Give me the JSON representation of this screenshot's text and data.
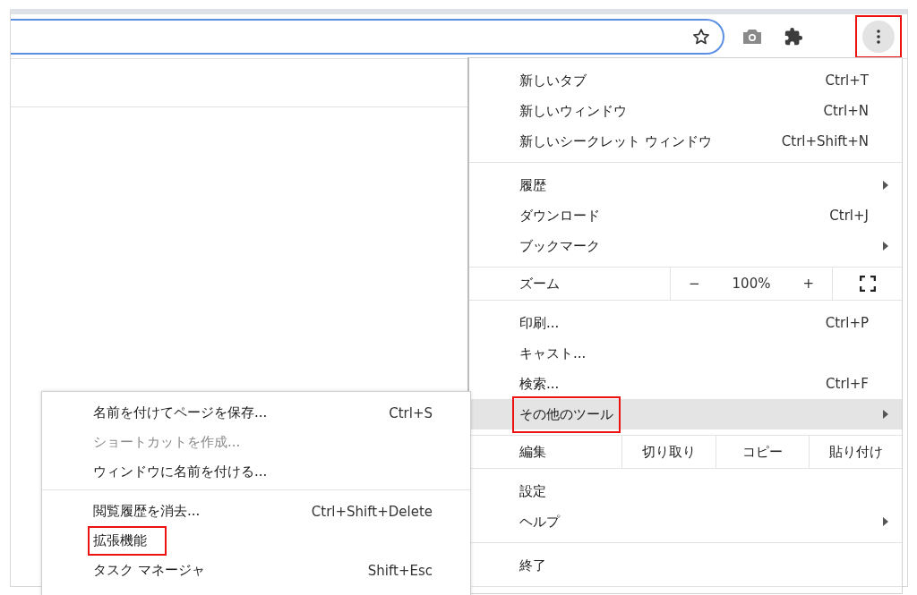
{
  "toolbar": {
    "menu_button": {
      "highlighted": true
    }
  },
  "menu": {
    "sections": [
      {
        "items": [
          {
            "kind": "item",
            "label": "新しいタブ",
            "shortcut": "Ctrl+T",
            "submenu": false,
            "selected": false,
            "highlighted": false
          },
          {
            "kind": "item",
            "label": "新しいウィンドウ",
            "shortcut": "Ctrl+N",
            "submenu": false,
            "selected": false,
            "highlighted": false
          },
          {
            "kind": "item",
            "label": "新しいシークレット ウィンドウ",
            "shortcut": "Ctrl+Shift+N",
            "submenu": false,
            "selected": false,
            "highlighted": false
          }
        ]
      },
      {
        "items": [
          {
            "kind": "item",
            "label": "履歴",
            "submenu": true,
            "selected": false,
            "highlighted": false
          },
          {
            "kind": "item",
            "label": "ダウンロード",
            "shortcut": "Ctrl+J",
            "submenu": false,
            "selected": false,
            "highlighted": false
          },
          {
            "kind": "item",
            "label": "ブックマーク",
            "submenu": true,
            "selected": false,
            "highlighted": false
          }
        ]
      },
      {
        "items": [
          {
            "kind": "zoom",
            "label": "ズーム",
            "minus": "−",
            "zoom_text": "100%",
            "plus": "+"
          }
        ]
      },
      {
        "items": [
          {
            "kind": "item",
            "label": "印刷...",
            "shortcut": "Ctrl+P",
            "submenu": false,
            "selected": false,
            "highlighted": false
          },
          {
            "kind": "item",
            "label": "キャスト...",
            "submenu": false,
            "selected": false,
            "highlighted": false
          },
          {
            "kind": "item",
            "label": "検索...",
            "shortcut": "Ctrl+F",
            "submenu": false,
            "selected": false,
            "highlighted": false
          },
          {
            "kind": "item",
            "label": "その他のツール",
            "submenu": true,
            "selected": true,
            "highlighted": true
          }
        ]
      },
      {
        "items": [
          {
            "kind": "edit",
            "label": "編集",
            "actions": [
              "切り取り",
              "コピー",
              "貼り付け"
            ]
          }
        ]
      },
      {
        "items": [
          {
            "kind": "item",
            "label": "設定",
            "submenu": false,
            "selected": false,
            "highlighted": false
          },
          {
            "kind": "item",
            "label": "ヘルプ",
            "submenu": true,
            "selected": false,
            "highlighted": false
          }
        ]
      },
      {
        "items": [
          {
            "kind": "item",
            "label": "終了",
            "submenu": false,
            "selected": false,
            "highlighted": false
          }
        ]
      }
    ]
  },
  "submenu": {
    "sections": [
      {
        "items": [
          {
            "label": "名前を付けてページを保存...",
            "shortcut": "Ctrl+S",
            "disabled": false,
            "highlighted": false
          },
          {
            "label": "ショートカットを作成...",
            "disabled": true,
            "highlighted": false
          },
          {
            "label": "ウィンドウに名前を付ける...",
            "disabled": false,
            "highlighted": false
          }
        ]
      },
      {
        "items": [
          {
            "label": "閲覧履歴を消去...",
            "shortcut": "Ctrl+Shift+Delete",
            "disabled": false,
            "highlighted": false
          },
          {
            "label": "拡張機能",
            "disabled": false,
            "highlighted": true
          },
          {
            "label": "タスク マネージャ",
            "shortcut": "Shift+Esc",
            "disabled": false,
            "highlighted": false
          }
        ]
      }
    ]
  }
}
